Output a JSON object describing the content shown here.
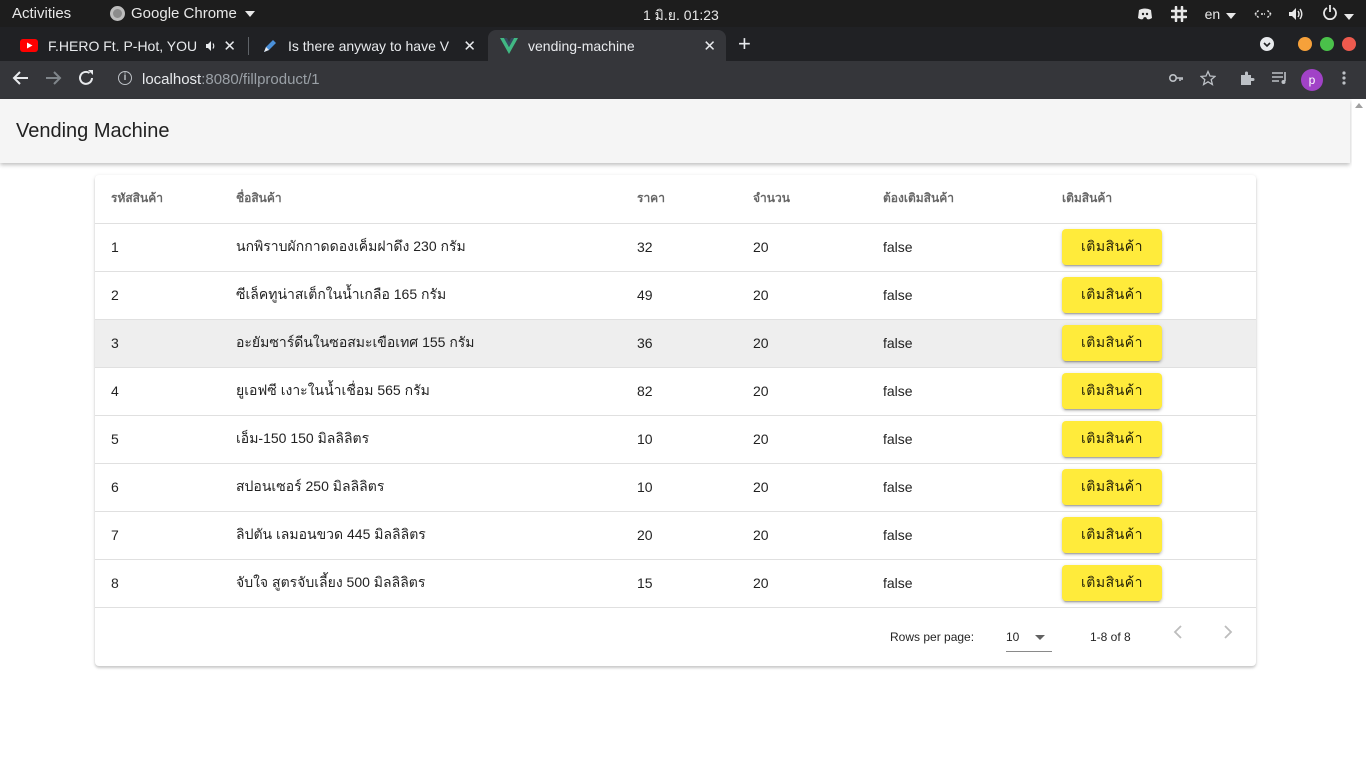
{
  "system": {
    "activities": "Activities",
    "app_name": "Google Chrome",
    "clock": "1 มิ.ย.  01:23",
    "lang": "en"
  },
  "tabs": [
    {
      "title": "F.HERO Ft. P-Hot, YOU",
      "icon": "youtube-icon"
    },
    {
      "title": "Is there anyway to have V",
      "icon": "pencil-icon"
    },
    {
      "title": "vending-machine",
      "icon": "vue-icon"
    }
  ],
  "toolbar": {
    "url_host": "localhost",
    "url_path": ":8080/fillproduct/1",
    "avatar_letter": "p"
  },
  "app": {
    "title": "Vending Machine"
  },
  "table": {
    "headers": [
      "รหัสสินค้า",
      "ชื่อสินค้า",
      "ราคา",
      "จำนวน",
      "ต้องเติมสินค้า",
      "เติมสินค้า"
    ],
    "button_label": "เติมสินค้า",
    "rows": [
      {
        "id": "1",
        "name": "นกพิราบผักกาดดองเค็มฝาดึง 230 กรัม",
        "price": "32",
        "qty": "20",
        "need_refill": "false"
      },
      {
        "id": "2",
        "name": "ซีเล็คทูน่าสเต็กในน้ำเกลือ 165 กรัม",
        "price": "49",
        "qty": "20",
        "need_refill": "false"
      },
      {
        "id": "3",
        "name": "อะยัมซาร์ดีนในซอสมะเขือเทศ 155 กรัม",
        "price": "36",
        "qty": "20",
        "need_refill": "false"
      },
      {
        "id": "4",
        "name": "ยูเอฟซี เงาะในน้ำเชื่อม 565 กรัม",
        "price": "82",
        "qty": "20",
        "need_refill": "false"
      },
      {
        "id": "5",
        "name": "เอ็ม-150 150 มิลลิลิตร",
        "price": "10",
        "qty": "20",
        "need_refill": "false"
      },
      {
        "id": "6",
        "name": "สปอนเซอร์ 250 มิลลิลิตร",
        "price": "10",
        "qty": "20",
        "need_refill": "false"
      },
      {
        "id": "7",
        "name": "ลิปตัน เลมอนขวด 445 มิลลิลิตร",
        "price": "20",
        "qty": "20",
        "need_refill": "false"
      },
      {
        "id": "8",
        "name": "จับใจ สูตรจับเลี้ยง 500 มิลลิลิตร",
        "price": "15",
        "qty": "20",
        "need_refill": "false"
      }
    ]
  },
  "pagination": {
    "rows_per_page_label": "Rows per page:",
    "rows_per_page": "10",
    "range": "1-8 of 8"
  },
  "colors": {
    "button": "#ffeb3b",
    "appbar": "#f5f5f5",
    "chrome_dark": "#202124"
  }
}
